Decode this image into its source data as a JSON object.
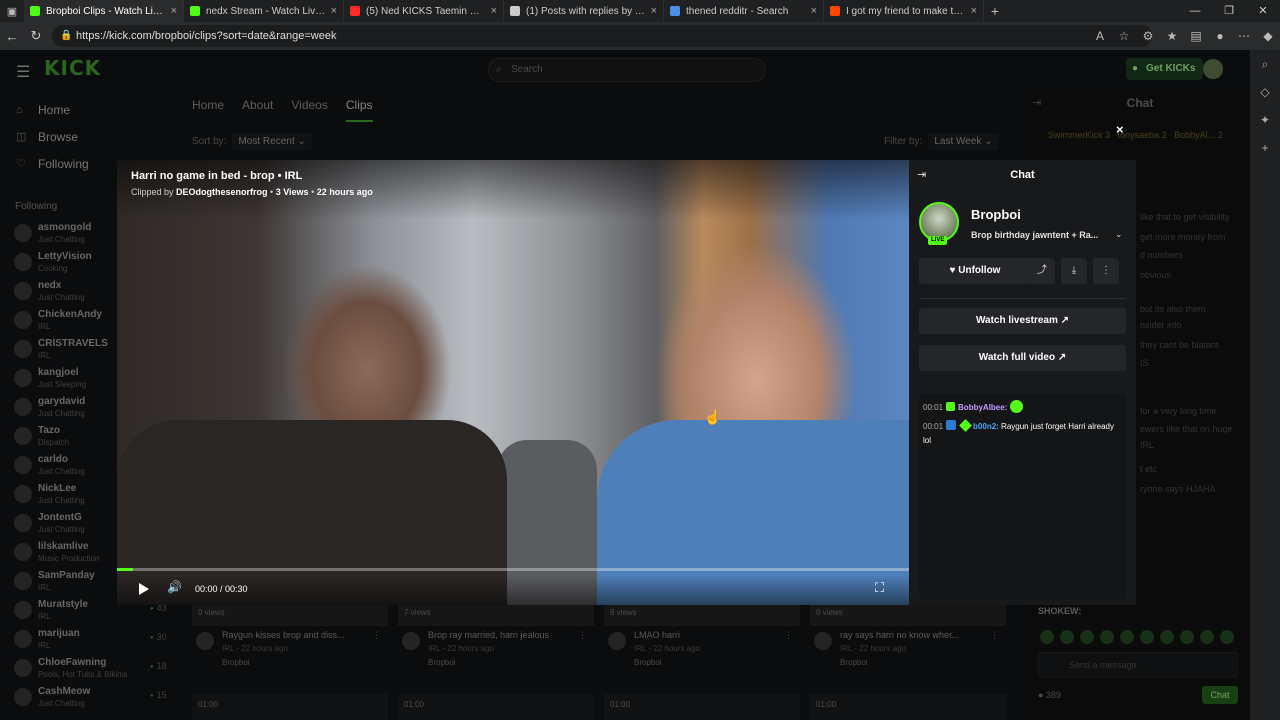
{
  "browser": {
    "tabs": [
      {
        "title": "Bropboi Clips - Watch Live on Kick",
        "color": "#53fc18",
        "active": true
      },
      {
        "title": "nedx Stream - Watch Live on Kick",
        "color": "#53fc18",
        "active": false
      },
      {
        "title": "(5) Ned KICKS Taemin Out of Rest",
        "color": "#ff2a2a",
        "active": false
      },
      {
        "title": "(1) Posts with replies by Tokyo In",
        "color": "#cccccc",
        "active": false
      },
      {
        "title": "thened redditr - Search",
        "color": "#4a8fe8",
        "active": false
      },
      {
        "title": "I got my friend to make these sh",
        "color": "#ff4500",
        "active": false
      }
    ],
    "url": "https://kick.com/bropboi/clips?sort=date&range=week"
  },
  "header": {
    "logo": "KICK",
    "search_placeholder": "Search",
    "get_kicks": "Get KICKs"
  },
  "sidebar": {
    "nav": [
      {
        "label": "Home",
        "icon": "home-icon"
      },
      {
        "label": "Browse",
        "icon": "browse-icon"
      },
      {
        "label": "Following",
        "icon": "heart-icon"
      }
    ],
    "following_heading": "Following",
    "following": [
      {
        "name": "asmongold",
        "sub": "Just Chatting",
        "count": ""
      },
      {
        "name": "LettyVision",
        "sub": "Cooking",
        "count": ""
      },
      {
        "name": "nedx",
        "sub": "Just Chatting",
        "count": ""
      },
      {
        "name": "ChickenAndy",
        "sub": "IRL",
        "count": ""
      },
      {
        "name": "CRISTRAVELS",
        "sub": "IRL",
        "count": ""
      },
      {
        "name": "kangjoel",
        "sub": "Just Sleeping",
        "count": ""
      },
      {
        "name": "garydavid",
        "sub": "Just Chatting",
        "count": ""
      },
      {
        "name": "Tazo",
        "sub": "Dispatch",
        "count": ""
      },
      {
        "name": "carldo",
        "sub": "Just Chatting",
        "count": ""
      },
      {
        "name": "NickLee",
        "sub": "Just Chatting",
        "count": ""
      },
      {
        "name": "JontentG",
        "sub": "Just Chatting",
        "count": ""
      },
      {
        "name": "lilskamlive",
        "sub": "Music Production",
        "count": ""
      },
      {
        "name": "SamPanday",
        "sub": "IRL",
        "count": ""
      },
      {
        "name": "Muratstyle",
        "sub": "IRL",
        "count": "43"
      },
      {
        "name": "marijuan",
        "sub": "IRL",
        "count": "30"
      },
      {
        "name": "ChloeFawning",
        "sub": "Pools, Hot Tubs & Bikinis",
        "count": "18"
      },
      {
        "name": "CashMeow",
        "sub": "Just Chatting",
        "count": "15"
      }
    ]
  },
  "channel": {
    "tabs": [
      "Home",
      "About",
      "Videos",
      "Clips"
    ],
    "active_tab": "Clips",
    "sort_label": "Sort by:",
    "sort_value": "Most Recent",
    "filter_label": "Filter by:",
    "filter_value": "Last Week"
  },
  "clips": [
    {
      "views": "0 views",
      "title": "Raygun kisses brop and diss...",
      "cat": "IRL",
      "age": "22 hours ago",
      "channel": "Bropboi",
      "dur": "01:00"
    },
    {
      "views": "7 views",
      "title": "Brop ray married, harri jealous",
      "cat": "IRL",
      "age": "22 hours ago",
      "channel": "Bropboi",
      "dur": "01:00"
    },
    {
      "views": "6 views",
      "title": "LMAO harri",
      "cat": "IRL",
      "age": "22 hours ago",
      "channel": "Bropboi",
      "dur": "01:00"
    },
    {
      "views": "0 views",
      "title": "ray says harri no know wher...",
      "cat": "IRL",
      "age": "22 hours ago",
      "channel": "Bropboi",
      "dur": "01:00"
    }
  ],
  "bg_chat": {
    "title": "Chat",
    "gifters": [
      "SwimmerKick",
      "tonysaeba",
      "BobbyAl..."
    ],
    "gift_counts": [
      "3",
      "2",
      "2"
    ],
    "lines": [
      "like that to get visibility",
      "get more money from",
      "d numbers",
      "obvious",
      "but its also them",
      "nsider info",
      "they cant be blatant",
      "IS",
      "for a very long time",
      "ewers like that on huge",
      "IRL",
      "t etc",
      "ryone says HJAHA"
    ],
    "pinned": "SHOKEW:",
    "send_placeholder": "Send a message",
    "viewer_count": "389",
    "chat_button": "Chat"
  },
  "modal": {
    "close": "×",
    "video": {
      "title": "Harri no game in bed - brop",
      "category": "IRL",
      "clipped_by_label": "Clipped by",
      "clipper": "DEOdogthesenorfrog",
      "views": "3 Views",
      "age": "22 hours ago",
      "time": "00:00 / 00:30",
      "progress_pct": 2
    },
    "panel": {
      "title": "Chat",
      "streamer": "Bropboi",
      "live_badge": "LIVE",
      "stream_title": "Brop birthday jawntent + Ra...",
      "unfollow": "Unfollow",
      "watch_livestream": "Watch livestream",
      "watch_full_video": "Watch full video",
      "messages": [
        {
          "time": "00:01",
          "user": "BobbyAlbee",
          "text": ""
        },
        {
          "time": "00:01",
          "user": "b00n2",
          "text": "Raygun just forget Harri already lol"
        }
      ]
    }
  },
  "colors": {
    "accent": "#53fc18",
    "page_bg": "#0e0f10",
    "panel_bg": "#18191b"
  }
}
